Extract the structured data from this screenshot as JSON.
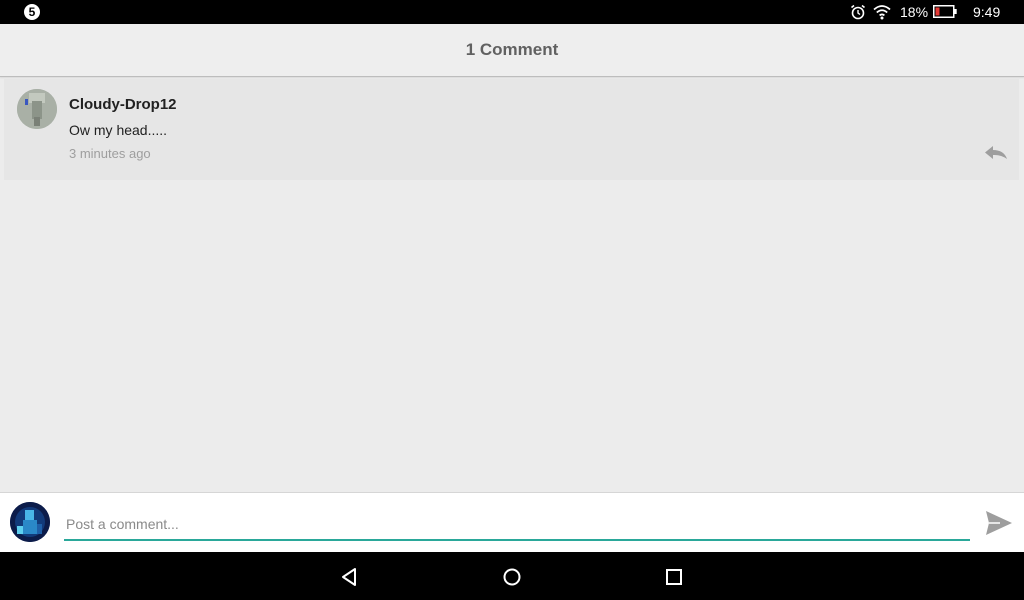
{
  "status_bar": {
    "notification_count": "5",
    "battery_percent": "18%",
    "time": "9:49",
    "icons": [
      "alarm-icon",
      "wifi-icon",
      "battery-icon"
    ]
  },
  "header": {
    "title": "1 Comment"
  },
  "comments": [
    {
      "author": "Cloudy-Drop12",
      "text": "Ow my head.....",
      "time_ago": "3 minutes ago",
      "reply_icon": "reply-icon"
    }
  ],
  "composer": {
    "placeholder": "Post a comment...",
    "value": "",
    "send_icon": "send-icon",
    "accent_color": "#2aa89a"
  },
  "nav_bar": {
    "icons": [
      "back-icon",
      "home-icon",
      "recent-apps-icon"
    ]
  }
}
